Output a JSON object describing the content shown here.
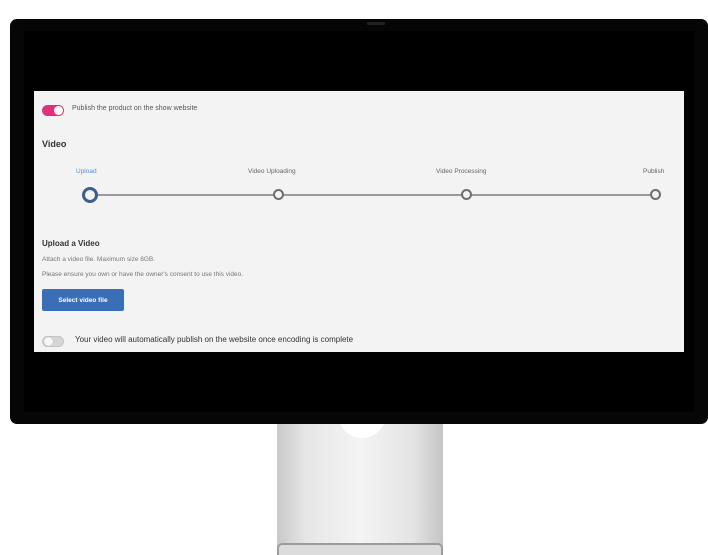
{
  "panel": {
    "publish_toggle": {
      "label": "Publish the product on the show website",
      "on": true
    },
    "video_heading": "Video",
    "steps": [
      {
        "label": "Upload",
        "active": true
      },
      {
        "label": "Video Uploading",
        "active": false
      },
      {
        "label": "Video Processing",
        "active": false
      },
      {
        "label": "Publish",
        "active": false
      }
    ],
    "upload": {
      "title": "Upload a Video",
      "description": "Attach a video file. Maximum size 8GB.",
      "consent": "Please ensure you own or have the owner's consent to use this video.",
      "button_label": "Select video file"
    },
    "auto_publish_toggle": {
      "label": "Your video will automatically publish on the website once encoding is complete",
      "on": false
    }
  },
  "colors": {
    "accent_pink": "#e0327a",
    "step_active": "#3d5f8f",
    "button_blue": "#3a6fb8",
    "panel_bg": "#f3f3f3",
    "bezel": "#060606"
  },
  "icons": {
    "step_markers": "circle-outline"
  }
}
